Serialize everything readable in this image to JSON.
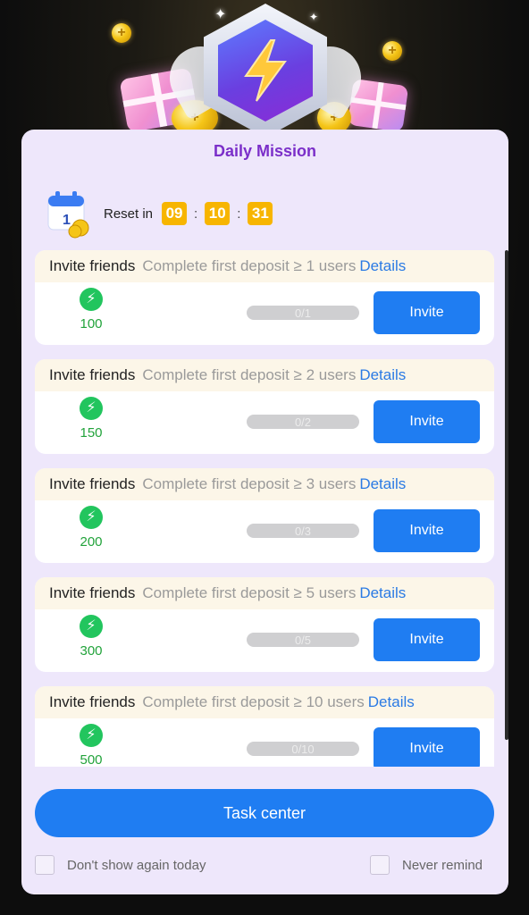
{
  "header": {
    "decorations": [
      "sparkle-icon",
      "coin-icon",
      "gift-icon",
      "lightning-badge-icon"
    ]
  },
  "dialog": {
    "title": "Daily Mission",
    "reset_label": "Reset in",
    "timer": {
      "hours": "09",
      "minutes": "10",
      "seconds": "31"
    },
    "tasks": [
      {
        "title": "Invite friends",
        "desc": "Complete first deposit ≥ 1 users",
        "link": "Details",
        "reward": "100",
        "progress_text": "0/1",
        "progress": 0,
        "button": "Invite"
      },
      {
        "title": "Invite friends",
        "desc": "Complete first deposit ≥ 2 users",
        "link": "Details",
        "reward": "150",
        "progress_text": "0/2",
        "progress": 0,
        "button": "Invite"
      },
      {
        "title": "Invite friends",
        "desc": "Complete first deposit ≥ 3 users",
        "link": "Details",
        "reward": "200",
        "progress_text": "0/3",
        "progress": 0,
        "button": "Invite"
      },
      {
        "title": "Invite friends",
        "desc": "Complete first deposit ≥ 5 users",
        "link": "Details",
        "reward": "300",
        "progress_text": "0/5",
        "progress": 0,
        "button": "Invite"
      },
      {
        "title": "Invite friends",
        "desc": "Complete first deposit ≥ 10 users",
        "link": "Details",
        "reward": "500",
        "progress_text": "0/10",
        "progress": 0,
        "button": "Invite"
      }
    ],
    "task_center_label": "Task center",
    "option_today": "Don't show again today",
    "option_never": "Never remind"
  },
  "colors": {
    "accent": "#1f7df2",
    "title": "#7b2fc9",
    "reward_green": "#22c55e",
    "timer_bg": "#f7b500",
    "link": "#2a7ae4"
  }
}
